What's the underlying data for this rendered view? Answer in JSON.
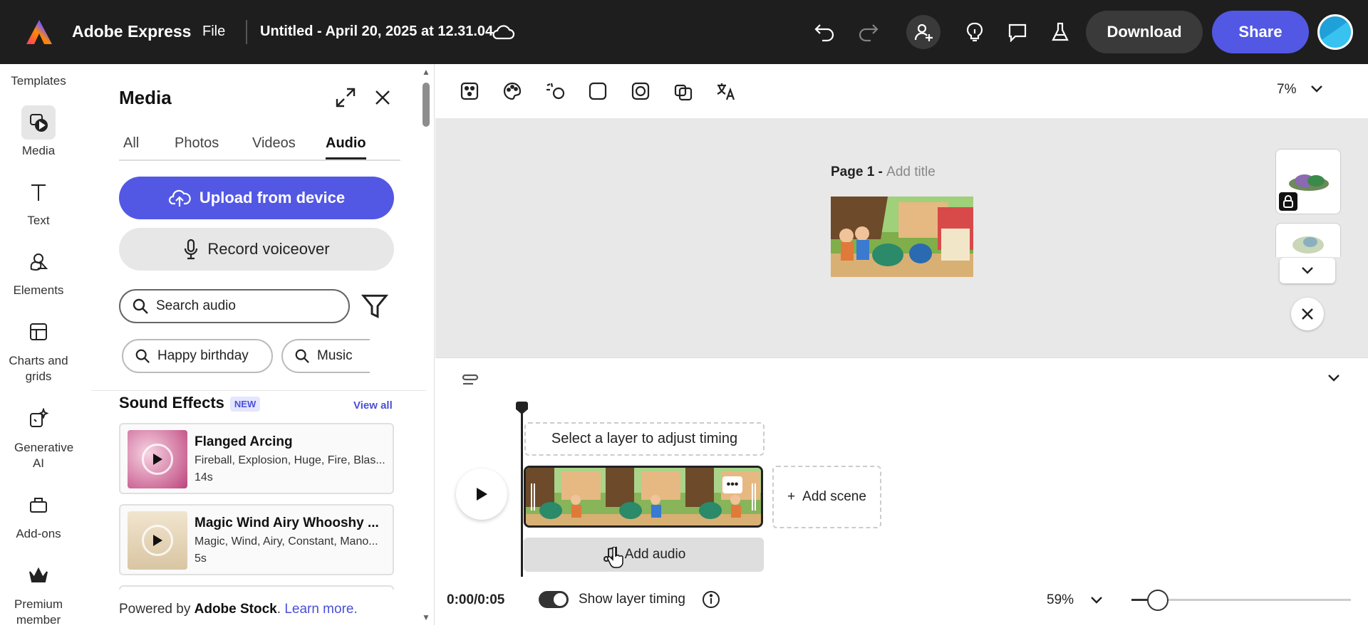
{
  "topbar": {
    "brand": "Adobe Express",
    "file_label": "File",
    "doc_title": "Untitled - April 20, 2025 at 12.31.04",
    "download_label": "Download",
    "share_label": "Share",
    "icons": [
      "adobe-logo-icon",
      "cloud-icon",
      "undo-icon",
      "redo-icon",
      "invite-user-icon",
      "lightbulb-icon",
      "comment-icon",
      "flask-icon",
      "avatar"
    ]
  },
  "rail": {
    "items": [
      {
        "label": "Templates",
        "icon": "templates-icon"
      },
      {
        "label": "Media",
        "icon": "media-icon",
        "active": true
      },
      {
        "label": "Text",
        "icon": "text-icon"
      },
      {
        "label": "Elements",
        "icon": "elements-icon"
      },
      {
        "label": "Charts and grids",
        "icon": "charts-icon"
      },
      {
        "label": "Generative AI",
        "icon": "generative-ai-icon"
      },
      {
        "label": "Add-ons",
        "icon": "add-ons-icon"
      },
      {
        "label": "Premium member",
        "icon": "premium-crown-icon"
      }
    ]
  },
  "panel": {
    "title": "Media",
    "tabs": [
      "All",
      "Photos",
      "Videos",
      "Audio"
    ],
    "active_tab": "Audio",
    "upload_label": "Upload from device",
    "record_label": "Record voiceover",
    "search_placeholder": "Search audio",
    "chips": [
      "Happy birthday",
      "Music"
    ],
    "section_title": "Sound Effects",
    "section_badge": "NEW",
    "view_all": "View all",
    "sounds": [
      {
        "name": "Flanged Arcing",
        "tags": "Fireball, Explosion, Huge, Fire, Blas...",
        "duration": "14s",
        "color": "#e3a8c4"
      },
      {
        "name": "Magic Wind Airy Whooshy ...",
        "tags": "Magic, Wind, Airy, Constant, Mano...",
        "duration": "5s",
        "color": "#e8dcc4"
      }
    ],
    "powered_prefix": "Powered by",
    "powered_brand": "Adobe Stock",
    "powered_suffix": ".",
    "learn_more": "Learn more."
  },
  "canvas": {
    "zoom": "7%",
    "page_label": "Page 1 -",
    "add_title": "Add title",
    "toolbar_icons": [
      "animate-icon",
      "color-palette-icon",
      "effects-icon",
      "shape-icon",
      "mask-icon",
      "layers-icon",
      "translate-icon"
    ]
  },
  "timeline": {
    "hint": "Select a layer to adjust timing",
    "add_scene": "Add scene",
    "add_audio": "Add audio",
    "time": "0:00/0:05",
    "show_layer_timing": "Show layer timing",
    "zoom": "59%",
    "zoom_slider_fraction": 0.12
  },
  "colors": {
    "accent": "#5258e4",
    "topbar": "#1e1e1e",
    "canvas_bg": "#e8e8e8"
  }
}
